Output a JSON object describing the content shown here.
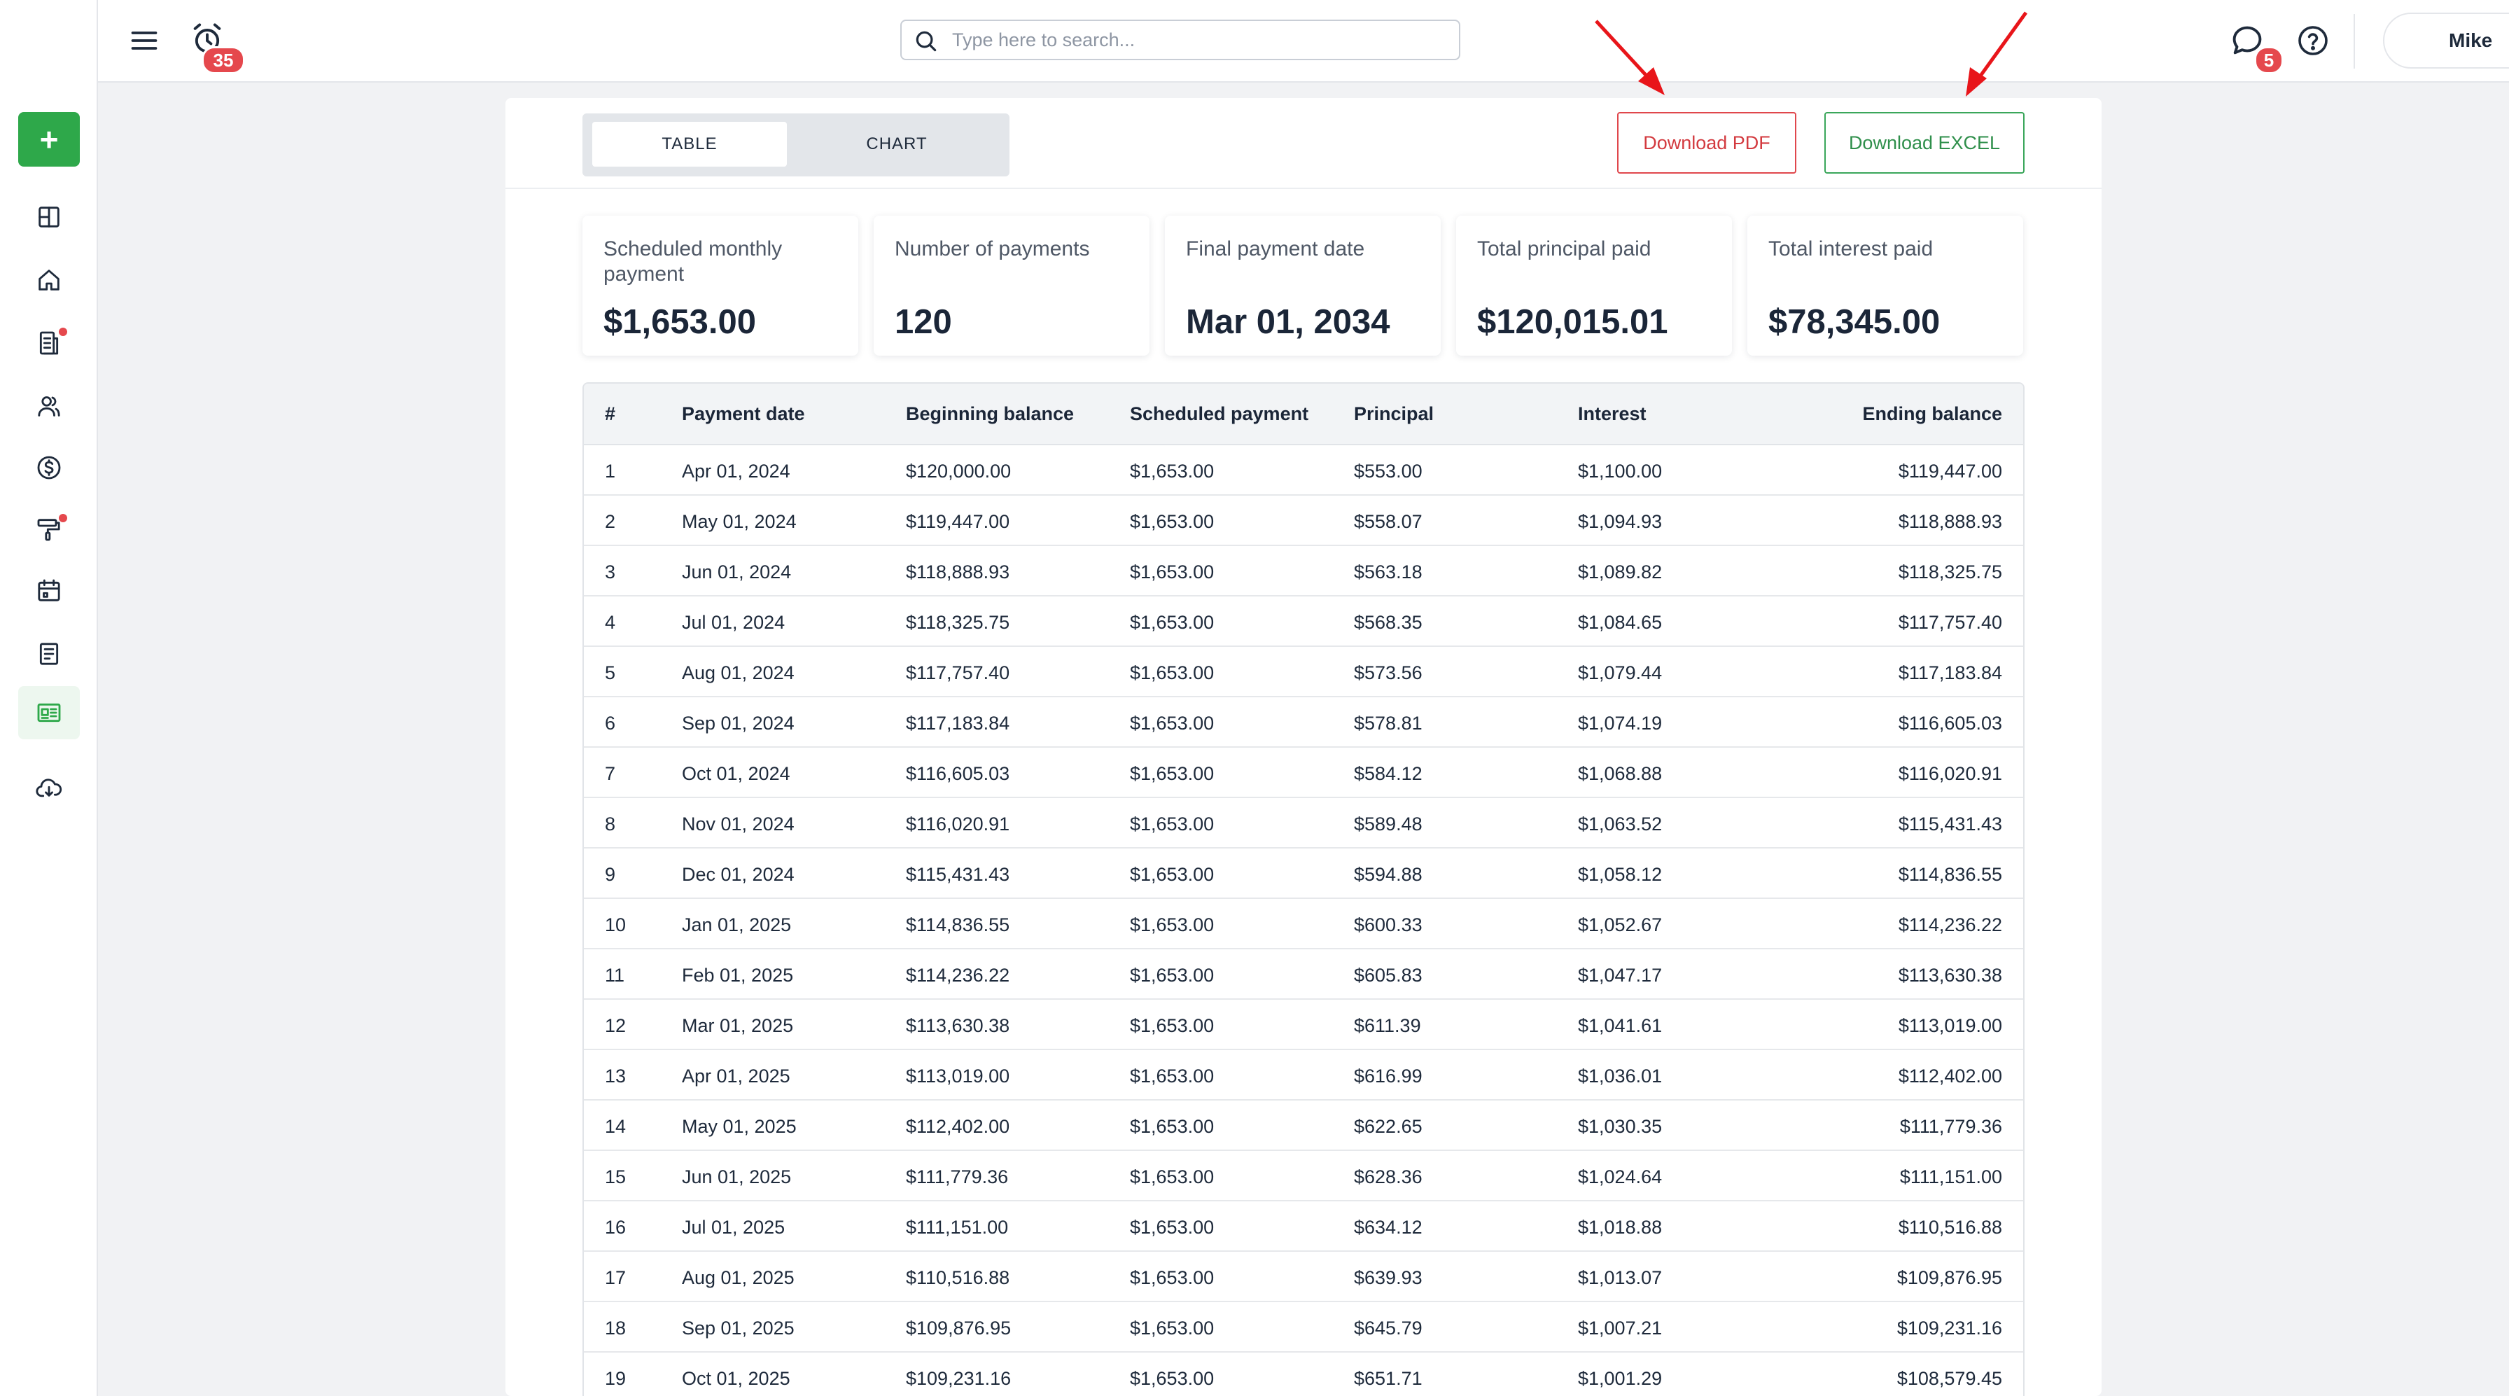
{
  "colors": {
    "accent_green": "#2ea84a",
    "danger_red": "#e5484d",
    "pdf_red": "#d33a3f",
    "excel_green": "#2f8f4b",
    "annotation_arrow": "#e8151a"
  },
  "sidebar": {
    "add_label": "+",
    "items": [
      {
        "icon": "dashboard-icon",
        "dot": false,
        "active": false
      },
      {
        "icon": "home-icon",
        "dot": false,
        "active": false
      },
      {
        "icon": "document-icon",
        "dot": true,
        "active": false
      },
      {
        "icon": "users-icon",
        "dot": false,
        "active": false
      },
      {
        "icon": "dollar-icon",
        "dot": false,
        "active": false
      },
      {
        "icon": "paint-roller-icon",
        "dot": true,
        "active": false
      },
      {
        "icon": "calendar-icon",
        "dot": false,
        "active": false
      },
      {
        "icon": "notes-icon",
        "dot": false,
        "active": false
      },
      {
        "icon": "calculator-icon",
        "dot": false,
        "active": true
      },
      {
        "icon": "cloud-download-icon",
        "dot": false,
        "active": false
      }
    ]
  },
  "topbar": {
    "alarm_count": "35",
    "search_placeholder": "Type here to search...",
    "chat_count": "5",
    "user_name": "Mike"
  },
  "view_toggle": {
    "table_label": "TABLE",
    "chart_label": "CHART",
    "selected": "TABLE"
  },
  "actions": {
    "pdf_label": "Download PDF",
    "excel_label": "Download EXCEL"
  },
  "summary": [
    {
      "label": "Scheduled monthly payment",
      "value": "$1,653.00"
    },
    {
      "label": "Number of payments",
      "value": "120"
    },
    {
      "label": "Final payment date",
      "value": "Mar 01, 2034"
    },
    {
      "label": "Total principal paid",
      "value": "$120,015.01"
    },
    {
      "label": "Total interest paid",
      "value": "$78,345.00"
    }
  ],
  "table": {
    "columns": [
      "#",
      "Payment date",
      "Beginning balance",
      "Scheduled payment",
      "Principal",
      "Interest",
      "Ending balance"
    ],
    "rows": [
      [
        "1",
        "Apr 01, 2024",
        "$120,000.00",
        "$1,653.00",
        "$553.00",
        "$1,100.00",
        "$119,447.00"
      ],
      [
        "2",
        "May 01, 2024",
        "$119,447.00",
        "$1,653.00",
        "$558.07",
        "$1,094.93",
        "$118,888.93"
      ],
      [
        "3",
        "Jun 01, 2024",
        "$118,888.93",
        "$1,653.00",
        "$563.18",
        "$1,089.82",
        "$118,325.75"
      ],
      [
        "4",
        "Jul 01, 2024",
        "$118,325.75",
        "$1,653.00",
        "$568.35",
        "$1,084.65",
        "$117,757.40"
      ],
      [
        "5",
        "Aug 01, 2024",
        "$117,757.40",
        "$1,653.00",
        "$573.56",
        "$1,079.44",
        "$117,183.84"
      ],
      [
        "6",
        "Sep 01, 2024",
        "$117,183.84",
        "$1,653.00",
        "$578.81",
        "$1,074.19",
        "$116,605.03"
      ],
      [
        "7",
        "Oct 01, 2024",
        "$116,605.03",
        "$1,653.00",
        "$584.12",
        "$1,068.88",
        "$116,020.91"
      ],
      [
        "8",
        "Nov 01, 2024",
        "$116,020.91",
        "$1,653.00",
        "$589.48",
        "$1,063.52",
        "$115,431.43"
      ],
      [
        "9",
        "Dec 01, 2024",
        "$115,431.43",
        "$1,653.00",
        "$594.88",
        "$1,058.12",
        "$114,836.55"
      ],
      [
        "10",
        "Jan 01, 2025",
        "$114,836.55",
        "$1,653.00",
        "$600.33",
        "$1,052.67",
        "$114,236.22"
      ],
      [
        "11",
        "Feb 01, 2025",
        "$114,236.22",
        "$1,653.00",
        "$605.83",
        "$1,047.17",
        "$113,630.38"
      ],
      [
        "12",
        "Mar 01, 2025",
        "$113,630.38",
        "$1,653.00",
        "$611.39",
        "$1,041.61",
        "$113,019.00"
      ],
      [
        "13",
        "Apr 01, 2025",
        "$113,019.00",
        "$1,653.00",
        "$616.99",
        "$1,036.01",
        "$112,402.00"
      ],
      [
        "14",
        "May 01, 2025",
        "$112,402.00",
        "$1,653.00",
        "$622.65",
        "$1,030.35",
        "$111,779.36"
      ],
      [
        "15",
        "Jun 01, 2025",
        "$111,779.36",
        "$1,653.00",
        "$628.36",
        "$1,024.64",
        "$111,151.00"
      ],
      [
        "16",
        "Jul 01, 2025",
        "$111,151.00",
        "$1,653.00",
        "$634.12",
        "$1,018.88",
        "$110,516.88"
      ],
      [
        "17",
        "Aug 01, 2025",
        "$110,516.88",
        "$1,653.00",
        "$639.93",
        "$1,013.07",
        "$109,876.95"
      ],
      [
        "18",
        "Sep 01, 2025",
        "$109,876.95",
        "$1,653.00",
        "$645.79",
        "$1,007.21",
        "$109,231.16"
      ],
      [
        "19",
        "Oct 01, 2025",
        "$109,231.16",
        "$1,653.00",
        "$651.71",
        "$1,001.29",
        "$108,579.45"
      ]
    ]
  }
}
